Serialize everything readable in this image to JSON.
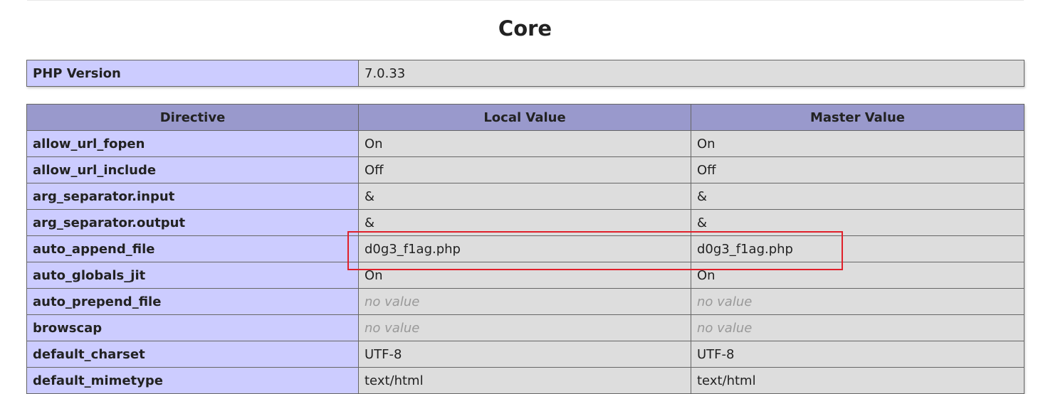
{
  "section_title": "Core",
  "php_version": {
    "label": "PHP Version",
    "value": "7.0.33"
  },
  "directives_table": {
    "headers": [
      "Directive",
      "Local Value",
      "Master Value"
    ],
    "rows": [
      {
        "directive": "allow_url_fopen",
        "local": "On",
        "master": "On",
        "no_value": false
      },
      {
        "directive": "allow_url_include",
        "local": "Off",
        "master": "Off",
        "no_value": false
      },
      {
        "directive": "arg_separator.input",
        "local": "&",
        "master": "&",
        "no_value": false
      },
      {
        "directive": "arg_separator.output",
        "local": "&",
        "master": "&",
        "no_value": false
      },
      {
        "directive": "auto_append_file",
        "local": "d0g3_f1ag.php",
        "master": "d0g3_f1ag.php",
        "no_value": false,
        "highlighted": true
      },
      {
        "directive": "auto_globals_jit",
        "local": "On",
        "master": "On",
        "no_value": false
      },
      {
        "directive": "auto_prepend_file",
        "local": "no value",
        "master": "no value",
        "no_value": true
      },
      {
        "directive": "browscap",
        "local": "no value",
        "master": "no value",
        "no_value": true
      },
      {
        "directive": "default_charset",
        "local": "UTF-8",
        "master": "UTF-8",
        "no_value": false
      },
      {
        "directive": "default_mimetype",
        "local": "text/html",
        "master": "text/html",
        "no_value": false
      }
    ]
  },
  "colors": {
    "header_bg": "#9999cc",
    "label_bg": "#ccccff",
    "value_bg": "#dddddd",
    "highlight_border": "#e0202a"
  }
}
